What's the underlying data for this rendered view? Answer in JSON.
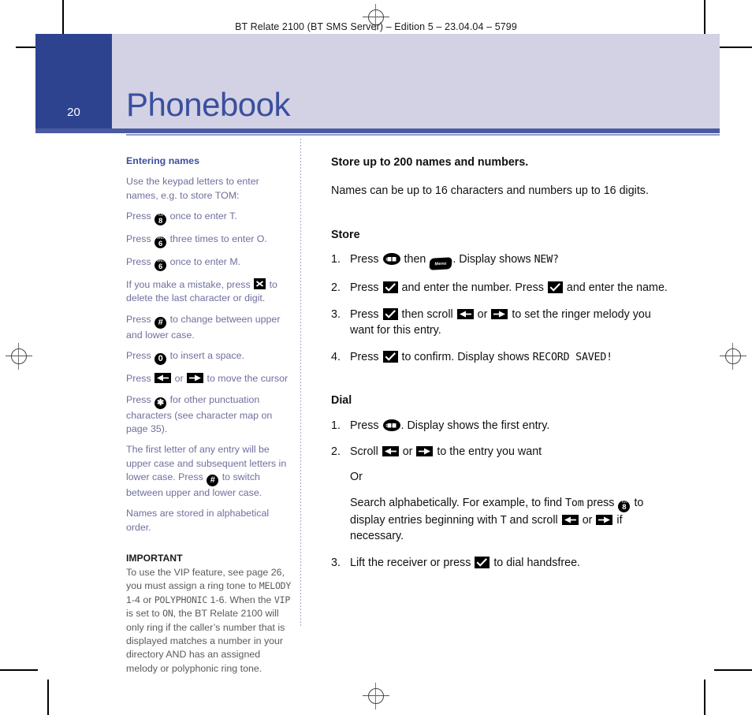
{
  "running_header": "BT Relate 2100 (BT SMS Server) – Edition 5 – 23.04.04 – 5799",
  "page_number": "20",
  "chapter_title": "Phonebook",
  "colors": {
    "page_block": "#2d4390",
    "band": "#d3d2e4",
    "title": "#3a4f9e",
    "left_text": "#6f6f9e",
    "rule": "#4a5aa0"
  },
  "left_column": {
    "heading": "Entering names",
    "intro": "Use the keypad letters to enter names, e.g. to store TOM:",
    "p_press_1_a": "Press",
    "p_press_1_b": "once to enter T.",
    "p_press_2_a": "Press",
    "p_press_2_b": "three times to enter O.",
    "p_press_3_a": "Press",
    "p_press_3_b": "once to enter M.",
    "p_mistake_a": "If you make a mistake, press",
    "p_mistake_b": "to delete the last character or digit.",
    "p_case_a": "Press",
    "p_case_b": "to change between upper and lower case.",
    "p_space_a": "Press",
    "p_space_b": "to insert a space.",
    "p_cursor_a": "Press",
    "p_cursor_mid": "or",
    "p_cursor_b": "to move the cursor",
    "p_punct_a": "Press",
    "p_punct_b": "for other punctuation characters (see character map on page 35).",
    "p_firstletter_a": "The first letter of any entry will be upper case and subsequent letters in lower case. Press",
    "p_firstletter_b": "to switch between upper and lower case.",
    "p_alpha": "Names are stored in alphabetical order.",
    "important_heading": "IMPORTANT",
    "important_1": "To use the VIP feature, see page 26, you must assign a ring tone to ",
    "important_lcd_1": "MELODY",
    "important_2": " 1-4 or ",
    "important_lcd_2": "POLYPHONIC",
    "important_3": " 1-6. When the ",
    "important_lcd_3": "VIP",
    "important_4": " is set to ",
    "important_lcd_4": "ON",
    "important_5": ", the BT Relate 2100 will only ring if the caller’s number that is displayed matches a number in your directory AND has an assigned melody or polyphonic ring tone."
  },
  "right_column": {
    "heading": "Store up to 200 names and numbers.",
    "intro": "Names can be up to 16 characters and numbers up to 16 digits.",
    "store_heading": "Store",
    "store_steps": [
      {
        "a": "Press",
        "b": "then",
        "c": ". Display shows",
        "lcd": "NEW?"
      },
      {
        "a": "Press",
        "b": "and enter the number. Press",
        "c": "and enter the name."
      },
      {
        "a": "Press",
        "b": "then scroll",
        "mid": "or",
        "c": "to set the ringer melody you want for this entry."
      },
      {
        "a": "Press",
        "b": "to confirm. Display shows",
        "lcd": "RECORD SAVED!"
      }
    ],
    "dial_heading": "Dial",
    "dial_step_1_a": "Press",
    "dial_step_1_b": ". Display shows the first entry.",
    "dial_step_2_a": "Scroll",
    "dial_step_2_mid": "or",
    "dial_step_2_b": "to the entry you want",
    "dial_or": "Or",
    "dial_search_a": "Search alphabetically. For example, to find",
    "dial_search_lcd_1": "Tom",
    "dial_search_b": "press",
    "dial_search_c": "to display entries beginning with",
    "dial_search_lcd_2": "T",
    "dial_search_d": "and scroll",
    "dial_search_mid": "or",
    "dial_search_e": "if necessary.",
    "dial_step_3_a": "Lift the receiver or press",
    "dial_step_3_b": "to dial handsfree."
  },
  "keys": {
    "key_8_sub": "TUV",
    "key_8_digit": "8",
    "key_6_sub": "MNO",
    "key_6_digit": "6",
    "key_0_digit": "0",
    "key_hash": "#",
    "key_star": "✱",
    "key_x": "x-key",
    "key_check": "tick-softkey",
    "key_left": "left-arrow-key",
    "key_right": "right-arrow-key",
    "key_phonebook": "phonebook-key",
    "key_menu_label": "Menu"
  }
}
